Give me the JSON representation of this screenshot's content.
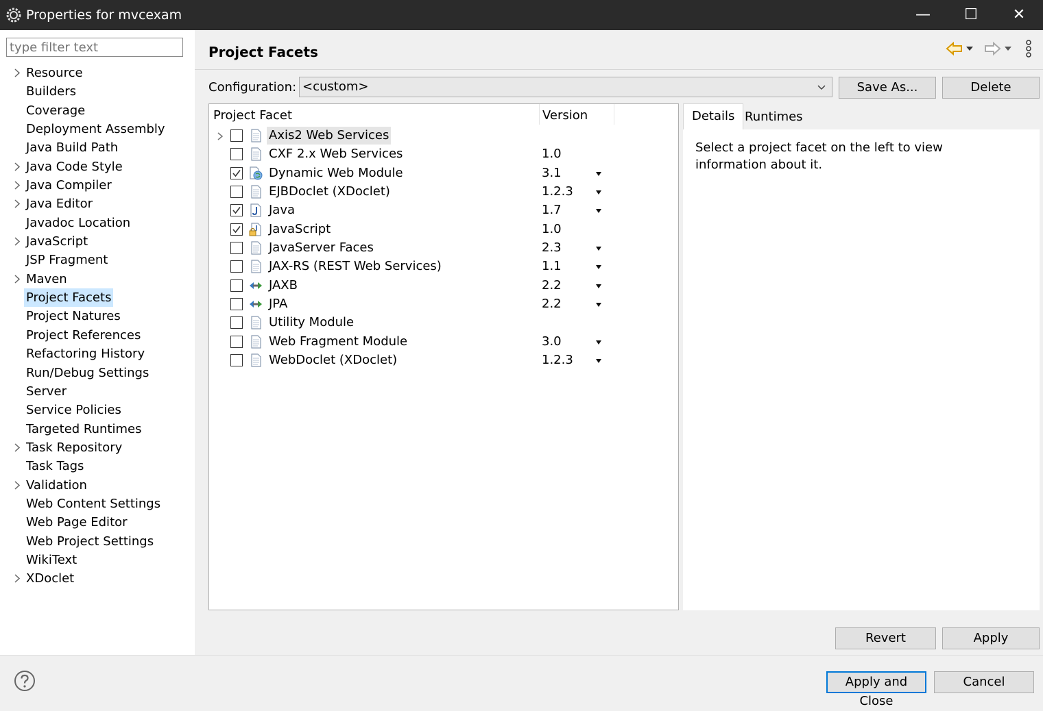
{
  "window": {
    "title": "Properties for mvcexam",
    "minimize": "—",
    "maximize": "☐",
    "close": "✕"
  },
  "sidebar": {
    "filter_placeholder": "type filter text",
    "items": [
      {
        "label": "Resource",
        "expandable": true
      },
      {
        "label": "Builders",
        "expandable": false
      },
      {
        "label": "Coverage",
        "expandable": false
      },
      {
        "label": "Deployment Assembly",
        "expandable": false
      },
      {
        "label": "Java Build Path",
        "expandable": false
      },
      {
        "label": "Java Code Style",
        "expandable": true
      },
      {
        "label": "Java Compiler",
        "expandable": true
      },
      {
        "label": "Java Editor",
        "expandable": true
      },
      {
        "label": "Javadoc Location",
        "expandable": false
      },
      {
        "label": "JavaScript",
        "expandable": true
      },
      {
        "label": "JSP Fragment",
        "expandable": false
      },
      {
        "label": "Maven",
        "expandable": true
      },
      {
        "label": "Project Facets",
        "expandable": false,
        "selected": true
      },
      {
        "label": "Project Natures",
        "expandable": false
      },
      {
        "label": "Project References",
        "expandable": false
      },
      {
        "label": "Refactoring History",
        "expandable": false
      },
      {
        "label": "Run/Debug Settings",
        "expandable": false
      },
      {
        "label": "Server",
        "expandable": false
      },
      {
        "label": "Service Policies",
        "expandable": false
      },
      {
        "label": "Targeted Runtimes",
        "expandable": false
      },
      {
        "label": "Task Repository",
        "expandable": true
      },
      {
        "label": "Task Tags",
        "expandable": false
      },
      {
        "label": "Validation",
        "expandable": true
      },
      {
        "label": "Web Content Settings",
        "expandable": false
      },
      {
        "label": "Web Page Editor",
        "expandable": false
      },
      {
        "label": "Web Project Settings",
        "expandable": false
      },
      {
        "label": "WikiText",
        "expandable": false
      },
      {
        "label": "XDoclet",
        "expandable": true
      }
    ]
  },
  "page": {
    "title": "Project Facets",
    "configuration_label": "Configuration:",
    "configuration_value": "<custom>",
    "save_as": "Save As...",
    "delete": "Delete",
    "col_facet": "Project Facet",
    "col_version": "Version",
    "facets": [
      {
        "name": "Axis2 Web Services",
        "version": "",
        "checked": false,
        "dropdown": false,
        "expander": true,
        "selected": true,
        "icon": "doc-icon"
      },
      {
        "name": "CXF 2.x Web Services",
        "version": "1.0",
        "checked": false,
        "dropdown": false,
        "icon": "doc-icon"
      },
      {
        "name": "Dynamic Web Module",
        "version": "3.1",
        "checked": true,
        "dropdown": true,
        "icon": "web-module-icon"
      },
      {
        "name": "EJBDoclet (XDoclet)",
        "version": "1.2.3",
        "checked": false,
        "dropdown": true,
        "icon": "doc-icon"
      },
      {
        "name": "Java",
        "version": "1.7",
        "checked": true,
        "dropdown": true,
        "icon": "java-icon"
      },
      {
        "name": "JavaScript",
        "version": "1.0",
        "checked": true,
        "dropdown": false,
        "icon": "javascript-lock-icon"
      },
      {
        "name": "JavaServer Faces",
        "version": "2.3",
        "checked": false,
        "dropdown": true,
        "icon": "doc-icon"
      },
      {
        "name": "JAX-RS (REST Web Services)",
        "version": "1.1",
        "checked": false,
        "dropdown": true,
        "icon": "doc-icon"
      },
      {
        "name": "JAXB",
        "version": "2.2",
        "checked": false,
        "dropdown": true,
        "icon": "arrows-icon"
      },
      {
        "name": "JPA",
        "version": "2.2",
        "checked": false,
        "dropdown": true,
        "icon": "arrows-icon"
      },
      {
        "name": "Utility Module",
        "version": "",
        "checked": false,
        "dropdown": false,
        "icon": "doc-icon"
      },
      {
        "name": "Web Fragment Module",
        "version": "3.0",
        "checked": false,
        "dropdown": true,
        "icon": "doc-icon"
      },
      {
        "name": "WebDoclet (XDoclet)",
        "version": "1.2.3",
        "checked": false,
        "dropdown": true,
        "icon": "doc-icon"
      }
    ],
    "tabs": {
      "details": "Details",
      "runtimes": "Runtimes"
    },
    "details_text": "Select a project facet on the left to view information about it.",
    "revert": "Revert",
    "apply": "Apply"
  },
  "footer": {
    "apply_and_close": "Apply and Close",
    "cancel": "Cancel"
  },
  "colors": {
    "selection": "#cce8ff",
    "accent": "#0078d7",
    "titlebar": "#2b2b2b"
  }
}
